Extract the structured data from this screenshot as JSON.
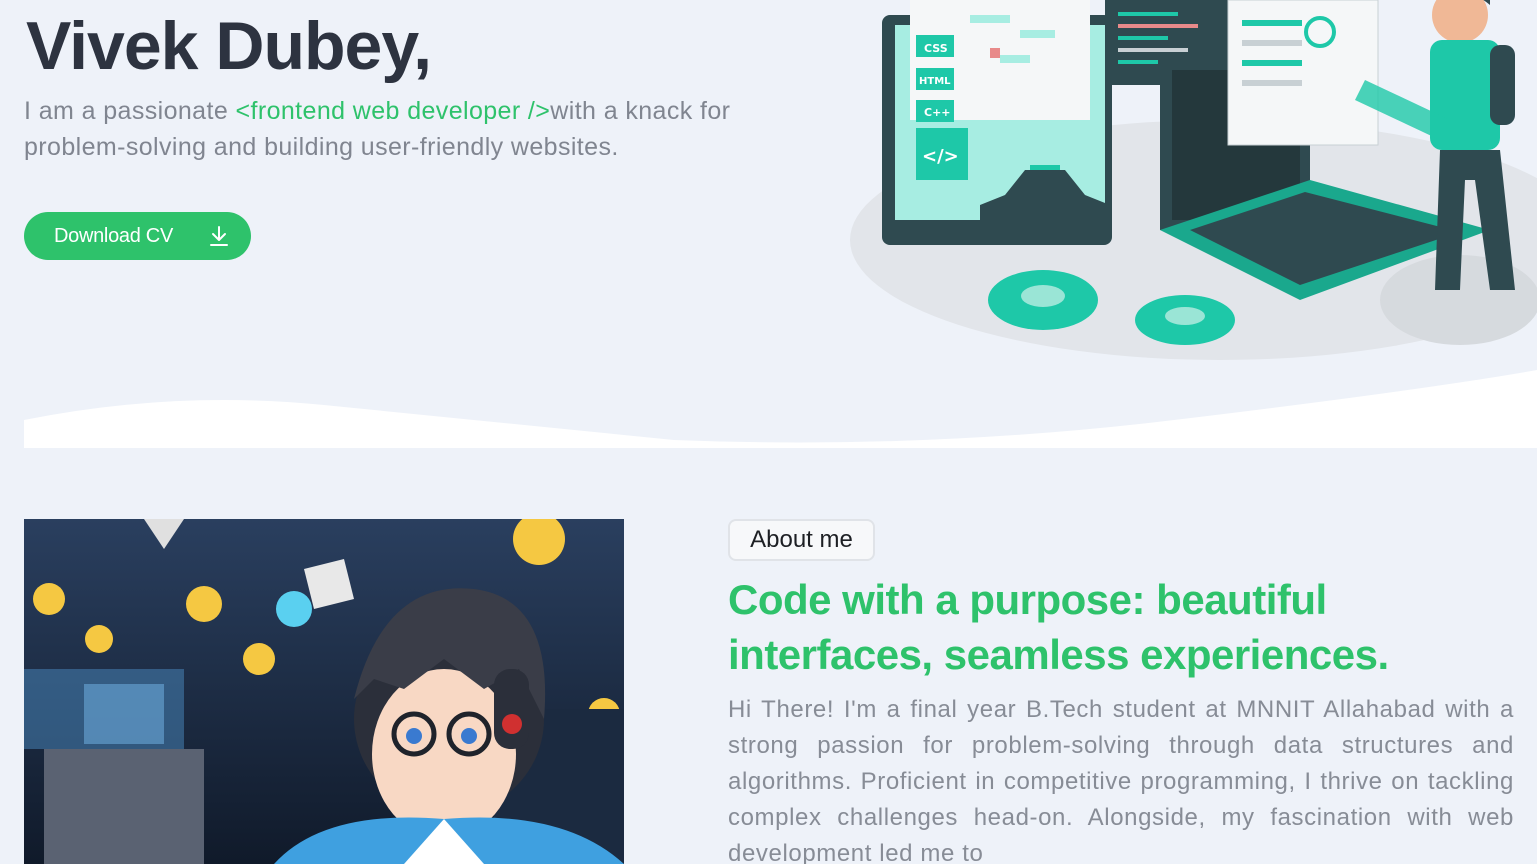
{
  "hero": {
    "name": "Vivek Dubey,",
    "desc_prefix": "I am a passionate ",
    "desc_highlight": "<frontend web developer />",
    "desc_suffix": "with a knack for problem-solving and building user-friendly websites.",
    "cv_button": "Download CV",
    "cv_icon": "download-icon"
  },
  "illustration": {
    "labels": [
      "CSS",
      "HTML",
      "C++",
      "</>"
    ],
    "accent": "#1ec8a8",
    "dark": "#2f4a50"
  },
  "about": {
    "badge": "About me",
    "heading": "Code with a purpose: beautiful interfaces, seamless experiences.",
    "body": "Hi There! I'm a final year B.Tech student at MNNIT Allahabad with a strong passion for problem-solving through data structures and algorithms. Proficient in competitive programming, I thrive on tackling complex challenges head-on. Alongside, my fascination with web development led me to"
  },
  "colors": {
    "background": "#eef2f9",
    "accent_green": "#2ec26b",
    "text_dark": "#2d3340",
    "text_muted": "#808590"
  }
}
